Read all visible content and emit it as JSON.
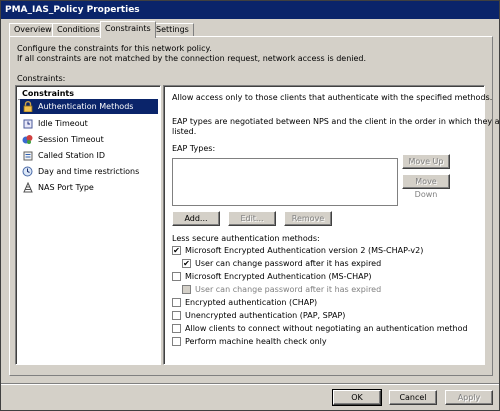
{
  "window": {
    "title": "PMA_IAS_Policy Properties"
  },
  "tabs": [
    {
      "label": "Overview"
    },
    {
      "label": "Conditions"
    },
    {
      "label": "Constraints",
      "active": true
    },
    {
      "label": "Settings"
    }
  ],
  "description": {
    "line1": "Configure the constraints for this network policy.",
    "line2": "If all constraints are not matched by the connection request, network access is denied."
  },
  "constraints_label": "Constraints:",
  "sidebar": {
    "header": "Constraints",
    "items": [
      {
        "label": "Authentication Methods",
        "icon": "lock-icon",
        "selected": true
      },
      {
        "label": "Idle Timeout",
        "icon": "idle-timeout-icon"
      },
      {
        "label": "Session Timeout",
        "icon": "session-timeout-icon"
      },
      {
        "label": "Called Station ID",
        "icon": "station-id-icon"
      },
      {
        "label": "Day and time restrictions",
        "icon": "calendar-icon"
      },
      {
        "label": "NAS Port Type",
        "icon": "port-icon"
      }
    ]
  },
  "auth": {
    "intro": "Allow access only to those clients that authenticate with the specified methods.",
    "eap_note_line1": "EAP types are negotiated between NPS and the client in the order in which they are",
    "eap_note_line2": "listed.",
    "eap_types_label": "EAP Types:",
    "buttons": {
      "move_up": "Move Up",
      "move_down": "Move Down",
      "add": "Add...",
      "edit": "Edit...",
      "remove": "Remove"
    },
    "less_secure_label": "Less secure authentication methods:",
    "options": [
      {
        "label": "Microsoft Encrypted Authentication version 2 (MS-CHAP-v2)",
        "checked": true,
        "indent": false,
        "disabled": false
      },
      {
        "label": "User can change password after it has expired",
        "checked": true,
        "indent": true,
        "disabled": false
      },
      {
        "label": "Microsoft Encrypted Authentication (MS-CHAP)",
        "checked": false,
        "indent": false,
        "disabled": false
      },
      {
        "label": "User can change password after it has expired",
        "checked": false,
        "indent": true,
        "disabled": true
      },
      {
        "label": "Encrypted authentication (CHAP)",
        "checked": false,
        "indent": false,
        "disabled": false
      },
      {
        "label": "Unencrypted authentication (PAP, SPAP)",
        "checked": false,
        "indent": false,
        "disabled": false
      },
      {
        "label": "Allow clients to connect without negotiating an authentication method",
        "checked": false,
        "indent": false,
        "disabled": false
      },
      {
        "label": "Perform machine health check only",
        "checked": false,
        "indent": false,
        "disabled": false
      }
    ]
  },
  "footer": {
    "ok": "OK",
    "cancel": "Cancel",
    "apply": "Apply"
  },
  "colors": {
    "titlebar": "#0a246a",
    "dialog_face": "#d4d0c8",
    "selection": "#0a246a"
  }
}
